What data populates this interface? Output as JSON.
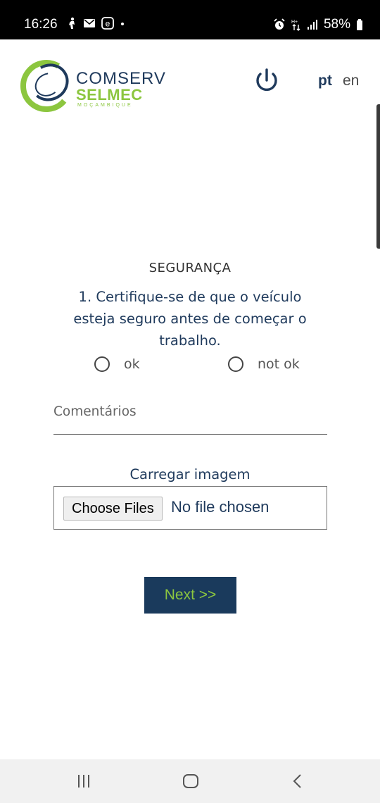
{
  "status_bar": {
    "time": "16:26",
    "battery": "58%"
  },
  "header": {
    "logo": {
      "line1": "COMSERV",
      "line2": "SELMEC",
      "line3": "MOÇAMBIQUE"
    },
    "lang_pt": "pt",
    "lang_en": "en"
  },
  "section": {
    "title": "SEGURANÇA",
    "question": "1. Certifique-se de que o veículo esteja seguro antes de começar o trabalho."
  },
  "options": {
    "ok": "ok",
    "not_ok": "not ok"
  },
  "comments": {
    "placeholder": "Comentários"
  },
  "upload": {
    "title": "Carregar imagem",
    "button_label": "Choose Files",
    "status": "No file chosen"
  },
  "next_button": "Next >>",
  "colors": {
    "brand_navy": "#1f3a5c",
    "brand_green": "#8cc63f"
  }
}
